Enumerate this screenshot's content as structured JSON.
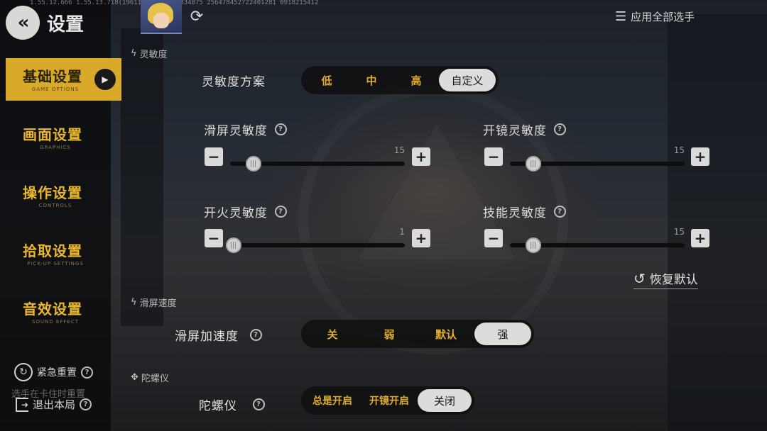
{
  "debug_text": "1.55.12.666  1.55.13.718(196115)  0  44000834875  256478452722401281  0918215412",
  "header": {
    "back_icon": "double-chevron-left-icon",
    "title": "设置",
    "apply_all_label": "应用全部选手"
  },
  "sidebar": {
    "items": [
      {
        "label": "基础设置",
        "sub": "GAME OPTIONS",
        "active": true
      },
      {
        "label": "画面设置",
        "sub": "GRAPHICS",
        "active": false
      },
      {
        "label": "操作设置",
        "sub": "CONTROLS",
        "active": false
      },
      {
        "label": "拾取设置",
        "sub": "PICK-UP SETTINGS",
        "active": false
      },
      {
        "label": "音效设置",
        "sub": "SOUND EFFECT",
        "active": false
      }
    ],
    "emergency_label": "紧急重置",
    "emergency_hint": "选手在卡住时重置",
    "exit_label": "退出本局"
  },
  "sensitivity": {
    "section_label": "灵敏度",
    "scheme_label": "灵敏度方案",
    "scheme_options": [
      "低",
      "中",
      "高",
      "自定义"
    ],
    "scheme_selected": "自定义",
    "sliders": [
      {
        "label": "滑屏灵敏度",
        "value": "15",
        "level": 0.1
      },
      {
        "label": "开镜灵敏度",
        "value": "15",
        "level": 0.1
      },
      {
        "label": "开火灵敏度",
        "value": "1",
        "level": 0.0
      },
      {
        "label": "技能灵敏度",
        "value": "15",
        "level": 0.1
      }
    ],
    "minus_label": "−",
    "plus_label": "+",
    "restore_label": "恢复默认"
  },
  "swipe_speed": {
    "section_label": "滑屏速度",
    "accel_label": "滑屏加速度",
    "options": [
      "关",
      "弱",
      "默认",
      "强"
    ],
    "selected": "强"
  },
  "gyro": {
    "section_label": "陀螺仪",
    "label": "陀螺仪",
    "options": [
      "总是开启",
      "开镜开启",
      "关闭"
    ],
    "selected": "关闭"
  },
  "colors": {
    "accent": "#d9a92a",
    "option_text": "#e0ad2f",
    "selected_bg": "#dcdcdc"
  }
}
